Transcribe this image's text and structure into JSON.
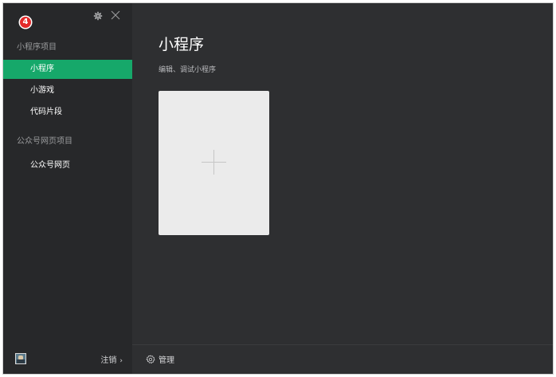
{
  "sidebar": {
    "badge_count": "4",
    "sections": [
      {
        "title": "小程序项目",
        "items": [
          {
            "label": "小程序",
            "active": true
          },
          {
            "label": "小游戏",
            "active": false
          },
          {
            "label": "代码片段",
            "active": false
          }
        ]
      },
      {
        "title": "公众号网页项目",
        "items": [
          {
            "label": "公众号网页",
            "active": false
          }
        ]
      }
    ],
    "footer": {
      "logout_label": "注销",
      "logout_chevron": "›"
    }
  },
  "main": {
    "title": "小程序",
    "subtitle": "编辑、调试小程序",
    "add_card_icon": "plus-icon",
    "footer": {
      "manage_label": "管理"
    }
  },
  "icons": {
    "settings": "gear-icon",
    "close": "close-icon",
    "manage": "gear-icon",
    "avatar": "avatar"
  },
  "colors": {
    "accent": "#16a86a",
    "badge": "#e32a2a",
    "sidebar_bg": "#27282a",
    "main_bg": "#2e2f31",
    "card_bg": "#ebebeb"
  }
}
